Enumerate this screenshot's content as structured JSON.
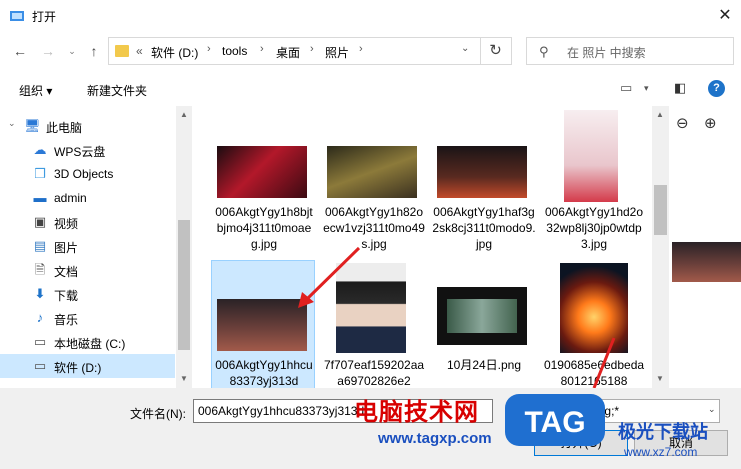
{
  "title": "打开",
  "breadcrumbs": {
    "overflow": "«",
    "items": [
      "软件 (D:)",
      "tools",
      "桌面",
      "照片"
    ],
    "sep": "›"
  },
  "search": {
    "placeholder": "在 照片 中搜索"
  },
  "toolbar": {
    "organize": "组织 ▾",
    "new_folder": "新建文件夹"
  },
  "nav": {
    "items": [
      {
        "label": "此电脑",
        "icon": "computer-icon"
      },
      {
        "label": "WPS云盘",
        "icon": "cloud-icon"
      },
      {
        "label": "3D Objects",
        "icon": "cube-icon"
      },
      {
        "label": "admin",
        "icon": "user-folder-icon"
      },
      {
        "label": "视频",
        "icon": "video-icon"
      },
      {
        "label": "图片",
        "icon": "picture-icon"
      },
      {
        "label": "文档",
        "icon": "document-icon"
      },
      {
        "label": "下载",
        "icon": "download-icon"
      },
      {
        "label": "音乐",
        "icon": "music-icon"
      },
      {
        "label": "本地磁盘 (C:)",
        "icon": "drive-icon"
      },
      {
        "label": "软件 (D:)",
        "icon": "drive-icon"
      }
    ]
  },
  "files": [
    {
      "label": "006AkgtYgy1h8bjtbjmo4j311t0moaeg.jpg",
      "icon": "red-figure-thumbnail"
    },
    {
      "label": "006AkgtYgy1h82oecw1vzj311t0mo49s.jpg",
      "icon": "golden-scene-thumbnail"
    },
    {
      "label": "006AkgtYgy1haf3g2sk8cj311t0modo9.jpg",
      "icon": "night-scene-thumbnail"
    },
    {
      "label": "006AkgtYgy1hd2o32wp8lj30jp0wtdp3.jpg",
      "icon": "anime-girl-thumbnail"
    },
    {
      "label": "006AkgtYgy1hhcu83373yj313d",
      "icon": "dark-stage-thumbnail"
    },
    {
      "label": "7f707eaf159202aaa69702826e2",
      "icon": "portrait-thumbnail"
    },
    {
      "label": "10月24日.png",
      "icon": "screen-thumbnail"
    },
    {
      "label": "0190685e6edbeda8012165188",
      "icon": "fire-thumbnail"
    }
  ],
  "bottom": {
    "filename_label": "文件名(N):",
    "filename_value": "006AkgtYgy1hhcu83373yj313d",
    "filetype": "(*.jpg;*.pjpeg;*.jpg;*",
    "open": "打开(O)",
    "cancel": "取消"
  },
  "watermark": {
    "cn": "电脑技术网",
    "url": "www.tagxp.com",
    "tag": "TAG",
    "cn2": "极光下载站",
    "url2": "www.xz7.com"
  }
}
